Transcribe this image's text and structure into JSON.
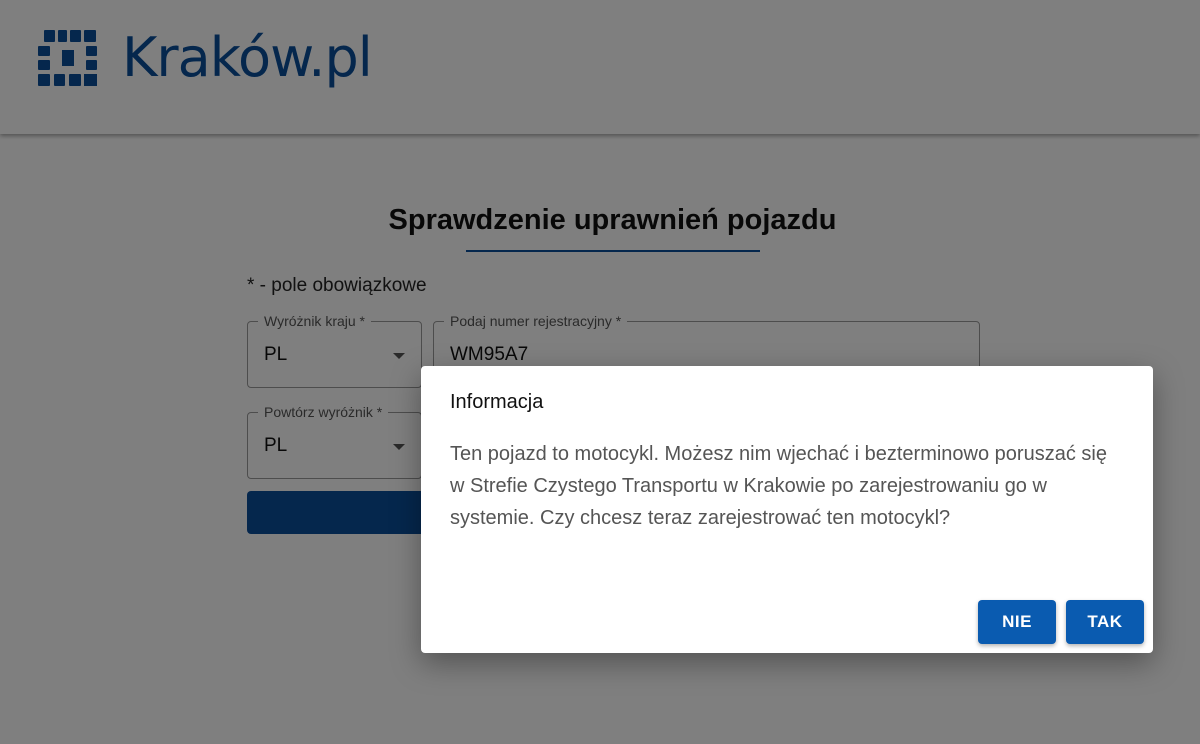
{
  "header": {
    "logo_text": "Kraków.pl"
  },
  "page": {
    "title": "Sprawdzenie uprawnień pojazdu",
    "required_note": "* - pole obowiązkowe"
  },
  "form": {
    "country": {
      "label": "Wyróżnik kraju *",
      "value": "PL"
    },
    "plate": {
      "label": "Podaj numer rejestracyjny *",
      "value": "WM95A7"
    },
    "repeat_country": {
      "label": "Powtórz wyróżnik *",
      "value": "PL"
    }
  },
  "dialog": {
    "title": "Informacja",
    "message": "Ten pojazd to motocykl. Możesz nim wjechać i bezterminowo poruszać się w Strefie Czystego Transportu w Krakowie po zarejestrowaniu go w systemie. Czy chcesz teraz zarejestrować ten motocykl?",
    "no_label": "NIE",
    "yes_label": "TAK"
  },
  "colors": {
    "brand": "#0a4f9b",
    "button": "#0a5bb0",
    "overlay": "rgba(0,0,0,0.5)"
  }
}
